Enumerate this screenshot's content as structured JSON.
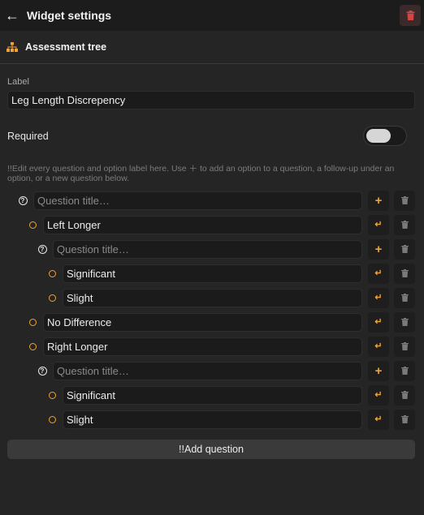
{
  "header": {
    "title": "Widget settings",
    "back_icon": "arrow-left-icon",
    "delete_icon": "trash-icon"
  },
  "section": {
    "title": "Assessment tree",
    "icon": "tree-icon"
  },
  "label_field": {
    "label": "Label",
    "value": "Leg Length Discrepency"
  },
  "required": {
    "label": "Required",
    "on": false
  },
  "help_text": "!!Edit every question and option label here. Use ＋ to add an option to a question, a follow-up under an option, or a new question below.",
  "rows": [
    {
      "kind": "question",
      "depth": 0,
      "value": "",
      "placeholder": "Question title…"
    },
    {
      "kind": "option",
      "depth": 1,
      "value": "Left Longer"
    },
    {
      "kind": "question",
      "depth": 2,
      "value": "",
      "placeholder": "Question title…"
    },
    {
      "kind": "option",
      "depth": 3,
      "value": "Significant"
    },
    {
      "kind": "option",
      "depth": 3,
      "value": "Slight"
    },
    {
      "kind": "option",
      "depth": 1,
      "value": "No Difference"
    },
    {
      "kind": "option",
      "depth": 1,
      "value": "Right Longer"
    },
    {
      "kind": "question",
      "depth": 2,
      "value": "",
      "placeholder": "Question title…"
    },
    {
      "kind": "option",
      "depth": 3,
      "value": "Significant"
    },
    {
      "kind": "option",
      "depth": 3,
      "value": "Slight"
    }
  ],
  "add_question_label": "!!Add question",
  "colors": {
    "accent": "#f0a23a",
    "background": "#252526",
    "danger": "#d04545"
  }
}
